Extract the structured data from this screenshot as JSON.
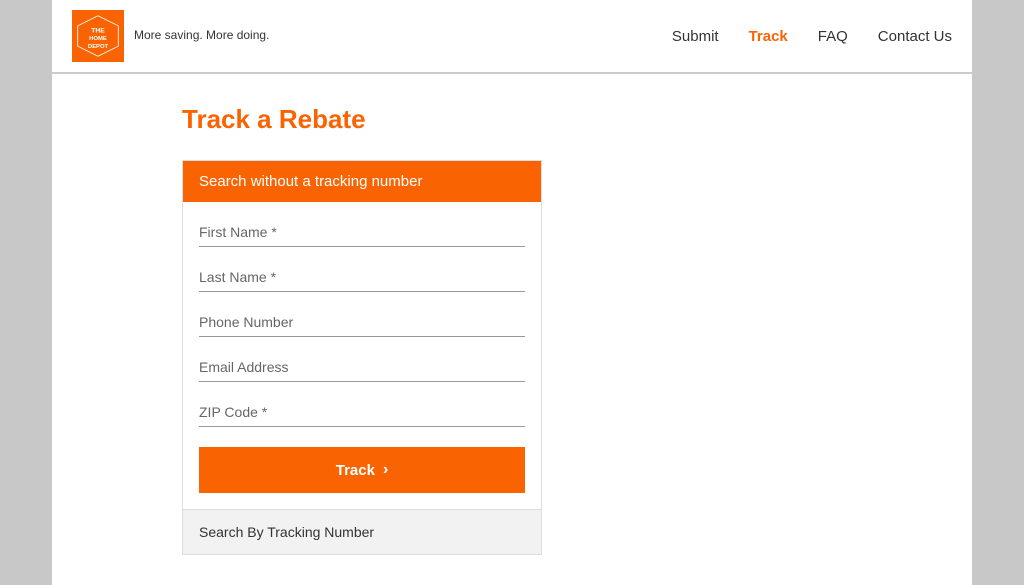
{
  "header": {
    "tagline": "More saving. More doing.",
    "nav": {
      "submit_label": "Submit",
      "track_label": "Track",
      "faq_label": "FAQ",
      "contact_label": "Contact Us"
    }
  },
  "main": {
    "page_title": "Track a Rebate",
    "form": {
      "search_header": "Search without a tracking number",
      "fields": {
        "first_name_placeholder": "First Name *",
        "last_name_placeholder": "Last Name *",
        "phone_placeholder": "Phone Number",
        "email_placeholder": "Email Address",
        "zip_placeholder": "ZIP Code *"
      },
      "track_button_label": "Track",
      "track_button_arrow": "›",
      "footer_label": "Search By Tracking Number"
    }
  }
}
